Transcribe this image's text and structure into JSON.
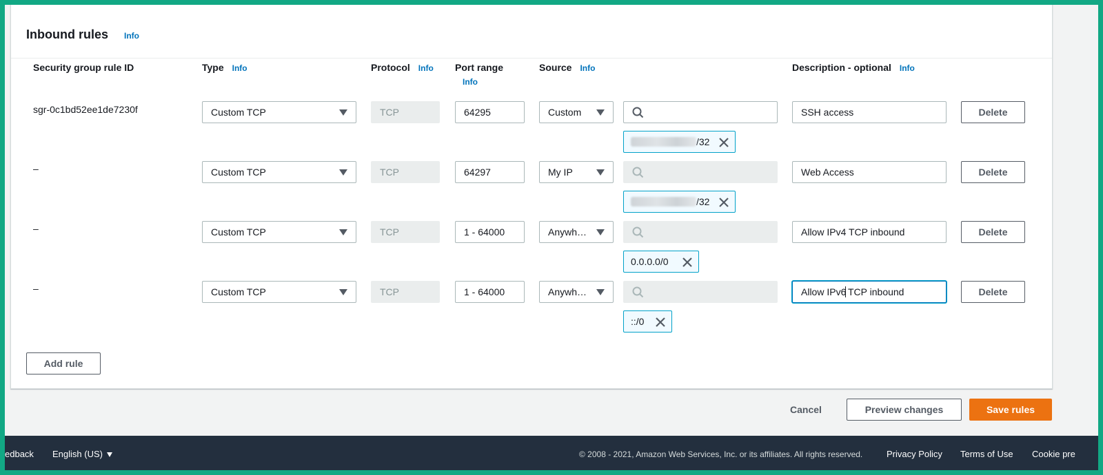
{
  "panel": {
    "title": "Inbound rules",
    "title_info": "Info"
  },
  "columns": {
    "rule_id": "Security group rule ID",
    "type": "Type",
    "type_info": "Info",
    "protocol": "Protocol",
    "protocol_info": "Info",
    "port_range": "Port range",
    "port_info": "Info",
    "source": "Source",
    "source_info": "Info",
    "description": "Description - optional",
    "description_info": "Info"
  },
  "rules": [
    {
      "id": "sgr-0c1bd52ee1de7230f",
      "type": "Custom TCP",
      "protocol": "TCP",
      "port": "64295",
      "source": "Custom",
      "token": "/32",
      "token_blurred": true,
      "description": "SSH access",
      "delete": "Delete",
      "search_enabled": true
    },
    {
      "id": "–",
      "type": "Custom TCP",
      "protocol": "TCP",
      "port": "64297",
      "source": "My IP",
      "token": "/32",
      "token_blurred": true,
      "description": "Web Access",
      "delete": "Delete",
      "search_enabled": false
    },
    {
      "id": "–",
      "type": "Custom TCP",
      "protocol": "TCP",
      "port": "1 - 64000",
      "source": "Anywh…",
      "token": "0.0.0.0/0",
      "token_blurred": false,
      "description": "Allow IPv4 TCP inbound",
      "delete": "Delete",
      "search_enabled": false
    },
    {
      "id": "–",
      "type": "Custom TCP",
      "protocol": "TCP",
      "port": "1 - 64000",
      "source": "Anywh…",
      "token": "::/0",
      "token_blurred": false,
      "description_before_cursor": "Allow IPv6",
      "description_after_cursor": " TCP inbound",
      "delete": "Delete",
      "search_enabled": false
    }
  ],
  "add_rule": "Add rule",
  "actions": {
    "cancel": "Cancel",
    "preview": "Preview changes",
    "save": "Save rules"
  },
  "footer": {
    "feedback": "edback",
    "language": "English (US)",
    "copyright": "© 2008 - 2021, Amazon Web Services, Inc. or its affiliates. All rights reserved.",
    "privacy": "Privacy Policy",
    "terms": "Terms of Use",
    "cookie": "Cookie pre"
  },
  "colors": {
    "border_frame": "#12a884",
    "link": "#0073bb",
    "primary": "#ec7211",
    "footer_bg": "#232f3e"
  }
}
